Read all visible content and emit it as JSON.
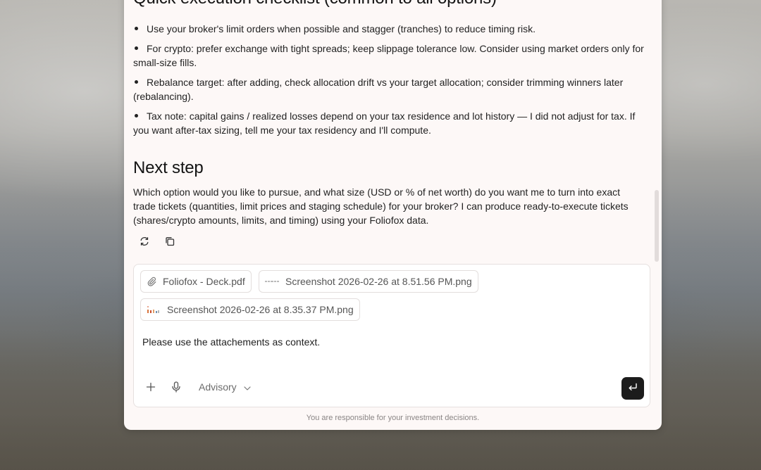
{
  "conversation": {
    "checklist_heading": "Quick execution checklist (common to all options)",
    "checklist_items": [
      "Use your broker's limit orders when possible and stagger (tranches) to reduce timing risk.",
      "For crypto: prefer exchange with tight spreads; keep slippage tolerance low. Consider using market orders only for small-size fills.",
      "Rebalance target: after adding, check allocation drift vs your target allocation; consider trimming winners later (rebalancing).",
      "Tax note: capital gains / realized losses depend on your tax residence and lot history — I did not adjust for tax. If you want after-tax sizing, tell me your tax residency and I'll compute."
    ],
    "next_heading": "Next step",
    "next_paragraph": "Which option would you like to pursue, and what size (USD or % of net worth) do you want me to turn into exact trade tickets (quantities, limit prices and staging schedule) for your broker? I can produce ready-to-execute tickets (shares/crypto amounts, limits, and timing) using your Foliofox data."
  },
  "message_actions": {
    "regenerate_icon": "refresh-icon",
    "copy_icon": "copy-icon"
  },
  "composer": {
    "attachments": [
      {
        "name": "Foliofox - Deck.pdf",
        "icon": "paperclip-icon"
      },
      {
        "name": "Screenshot 2026-02-26 at 8.51.56 PM.png",
        "icon": "thumbnail-icon"
      },
      {
        "name": "Screenshot 2026-02-26 at 8.35.37 PM.png",
        "icon": "thumbnail-icon"
      }
    ],
    "text": "Please use the attachements as context.",
    "mode_label": "Advisory",
    "send_icon": "enter-icon"
  },
  "disclaimer": "You are responsible for your investment decisions.",
  "colors": {
    "panel_bg": "#fdf8f7",
    "send_button": "#1c1c1c",
    "text": "#222222"
  }
}
